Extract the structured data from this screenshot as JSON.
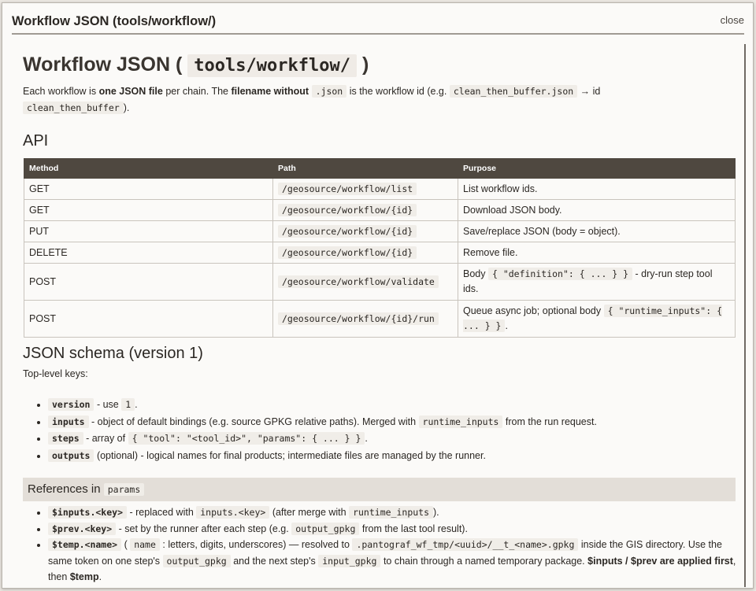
{
  "header": {
    "title": "Workflow JSON (tools/workflow/)",
    "close_label": "close"
  },
  "doc": {
    "h1_prefix": "Workflow JSON (",
    "h1_code": "tools/workflow/",
    "h1_suffix": ")",
    "intro": {
      "t1": "Each workflow is ",
      "b1": "one JSON file",
      "t2": " per chain. The ",
      "b2": "filename without",
      "c1": ".json",
      "t3": " is the workflow id (e.g. ",
      "c2": "clean_then_buffer.json",
      "t4": " → id ",
      "c3": "clean_then_buffer",
      "t5": ")."
    },
    "api_heading": "API",
    "api_table": {
      "headers": [
        "Method",
        "Path",
        "Purpose"
      ],
      "rows": [
        {
          "method": "GET",
          "path": "/geosource/workflow/list",
          "purpose": "List workflow ids."
        },
        {
          "method": "GET",
          "path": "/geosource/workflow/{id}",
          "purpose": "Download JSON body."
        },
        {
          "method": "PUT",
          "path": "/geosource/workflow/{id}",
          "purpose": "Save/replace JSON (body = object)."
        },
        {
          "method": "DELETE",
          "path": "/geosource/workflow/{id}",
          "purpose": "Remove file."
        },
        {
          "method": "POST",
          "path": "/geosource/workflow/validate",
          "purpose_pre": "Body ",
          "purpose_code": "{ \"definition\": { ... } }",
          "purpose_post": " - dry-run step tool ids."
        },
        {
          "method": "POST",
          "path": "/geosource/workflow/{id}/run",
          "purpose_pre": "Queue async job; optional body ",
          "purpose_code": "{ \"runtime_inputs\": { ... } }",
          "purpose_post": "."
        }
      ]
    },
    "schema_heading": "JSON schema (version 1)",
    "toplevel_label": "Top-level keys:",
    "keys": [
      {
        "key": "version",
        "pre": " - use ",
        "code": "1",
        "post": "."
      },
      {
        "key": "inputs",
        "pre": " - object of default bindings (e.g. source GPKG relative paths). Merged with ",
        "code": "runtime_inputs",
        "post": " from the run request."
      },
      {
        "key": "steps",
        "pre": " - array of ",
        "code": "{ \"tool\": \"<tool_id>\", \"params\": { ... } }",
        "post": "."
      },
      {
        "key": "outputs",
        "pre": " (optional) - logical names for final products; intermediate files are managed by the runner.",
        "code": "",
        "post": ""
      }
    ],
    "ref_heading_pre": "References in ",
    "ref_heading_code": "params",
    "refs": {
      "r1": {
        "key": "$inputs.<key>",
        "t1": " - replaced with ",
        "c1": "inputs.<key>",
        "t2": " (after merge with ",
        "c2": "runtime_inputs",
        "t3": ")."
      },
      "r2": {
        "key": "$prev.<key>",
        "t1": " - set by the runner after each step (e.g. ",
        "c1": "output_gpkg",
        "t2": " from the last tool result)."
      },
      "r3": {
        "key": "$temp.<name>",
        "t1": " ( ",
        "c1": "name",
        "t2": " : letters, digits, underscores) — resolved to ",
        "c2": ".pantograf_wf_tmp/<uuid>/__t_<name>.gpkg",
        "t3": " inside the GIS directory. Use the same token on one step's ",
        "c3": "output_gpkg",
        "t4": " and the next step's ",
        "c4": "input_gpkg",
        "t5": " to chain through a named temporary package. ",
        "b1": "$inputs / $prev are applied first",
        "t6": ", then ",
        "b2": "$temp",
        "t7": "."
      }
    }
  }
}
